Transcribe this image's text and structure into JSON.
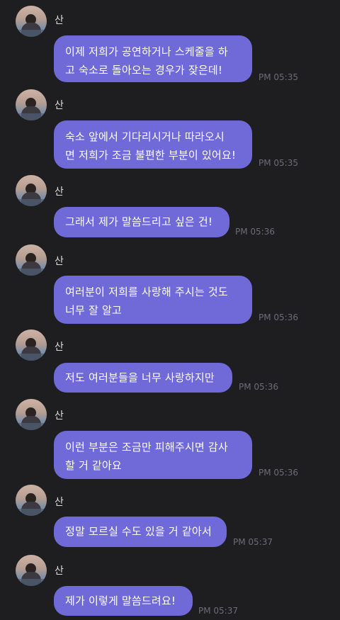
{
  "messages": [
    {
      "sender": "산",
      "text": "이제 저희가 공연하거나 스케줄을 하\n고 숙소로 돌아오는 경우가 잦은데!",
      "time": "PM 05:35"
    },
    {
      "sender": "산",
      "text": "숙소 앞에서 기다리시거나 따라오시\n면 저희가 조금 불편한 부분이 있어요!",
      "time": "PM 05:35"
    },
    {
      "sender": "산",
      "text": "그래서 제가 말씀드리고 싶은 건!",
      "time": "PM 05:36"
    },
    {
      "sender": "산",
      "text": "여러분이 저희를 사랑해 주시는 것도\n너무 잘 알고",
      "time": "PM 05:36"
    },
    {
      "sender": "산",
      "text": "저도 여러분들을 너무 사랑하지만",
      "time": "PM 05:36"
    },
    {
      "sender": "산",
      "text": "이런 부분은 조금만 피해주시면 감사\n할 거 같아요",
      "time": "PM 05:36"
    },
    {
      "sender": "산",
      "text": "정말 모르실 수도 있을 거 같아서",
      "time": "PM 05:37"
    },
    {
      "sender": "산",
      "text": "제가 이렇게 말씀드려요!",
      "time": "PM 05:37"
    }
  ]
}
